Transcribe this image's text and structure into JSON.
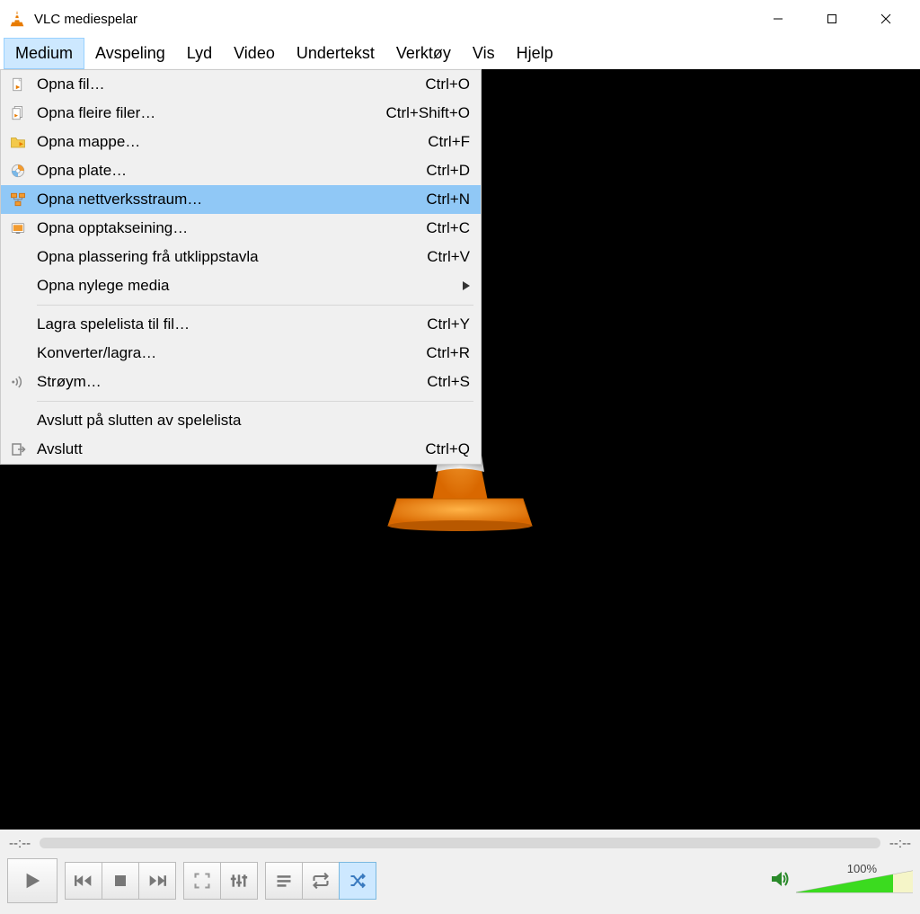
{
  "window": {
    "title": "VLC mediespelar"
  },
  "menubar": [
    {
      "label": "Medium",
      "active": true
    },
    {
      "label": "Avspeling"
    },
    {
      "label": "Lyd"
    },
    {
      "label": "Video"
    },
    {
      "label": "Undertekst"
    },
    {
      "label": "Verktøy"
    },
    {
      "label": "Vis"
    },
    {
      "label": "Hjelp"
    }
  ],
  "dropdown": {
    "items": [
      {
        "icon": "file",
        "label": "Opna fil…",
        "shortcut": "Ctrl+O"
      },
      {
        "icon": "files",
        "label": "Opna fleire filer…",
        "shortcut": "Ctrl+Shift+O"
      },
      {
        "icon": "folder",
        "label": "Opna mappe…",
        "shortcut": "Ctrl+F"
      },
      {
        "icon": "disc",
        "label": "Opna plate…",
        "shortcut": "Ctrl+D"
      },
      {
        "icon": "network",
        "label": "Opna nettverksstraum…",
        "shortcut": "Ctrl+N",
        "highlighted": true
      },
      {
        "icon": "capture",
        "label": "Opna opptakseining…",
        "shortcut": "Ctrl+C"
      },
      {
        "icon": "",
        "label": "Opna plassering frå utklippstavla",
        "shortcut": "Ctrl+V"
      },
      {
        "icon": "",
        "label": "Opna nylege media",
        "submenu": true
      },
      {
        "sep": true
      },
      {
        "icon": "",
        "label": "Lagra spelelista til fil…",
        "shortcut": "Ctrl+Y"
      },
      {
        "icon": "",
        "label": "Konverter/lagra…",
        "shortcut": "Ctrl+R"
      },
      {
        "icon": "stream",
        "label": "Strøym…",
        "shortcut": "Ctrl+S"
      },
      {
        "sep": true
      },
      {
        "icon": "",
        "label": "Avslutt på slutten av spelelista"
      },
      {
        "icon": "quit",
        "label": "Avslutt",
        "shortcut": "Ctrl+Q"
      }
    ]
  },
  "time": {
    "elapsed": "--:--",
    "total": "--:--"
  },
  "volume": {
    "label": "100%"
  }
}
